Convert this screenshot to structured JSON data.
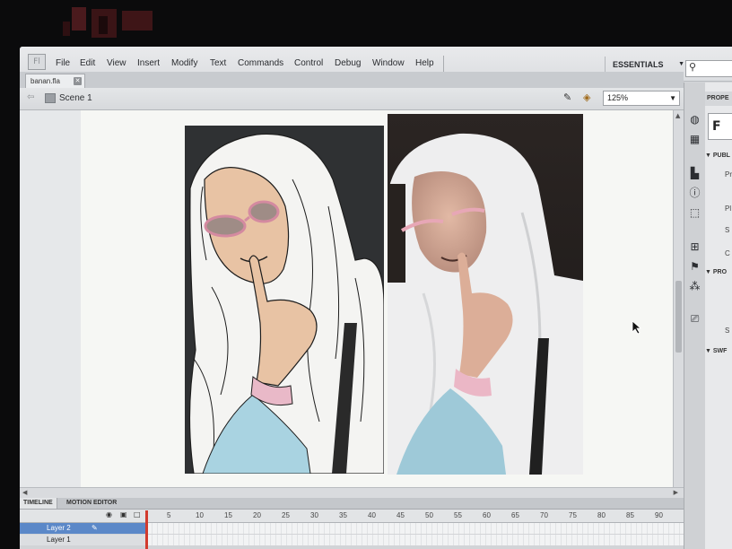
{
  "menu": {
    "items": [
      "File",
      "Edit",
      "View",
      "Insert",
      "Modify",
      "Text",
      "Commands",
      "Control",
      "Debug",
      "Window",
      "Help"
    ]
  },
  "workspace": {
    "label": "ESSENTIALS"
  },
  "document": {
    "tab_name": "banan.fla"
  },
  "scene": {
    "label": "Scene 1"
  },
  "zoom": {
    "value": "125%"
  },
  "properties": {
    "header": "PROPE",
    "doc_letter": "F",
    "sections": [
      "PUBL",
      "PRO",
      "SWF"
    ],
    "labels": [
      "Pr",
      "Pl",
      "S",
      "C",
      "S"
    ]
  },
  "timeline": {
    "tabs": [
      "TIMELINE",
      "MOTION EDITOR"
    ],
    "frame_numbers": [
      "5",
      "10",
      "15",
      "20",
      "25",
      "30",
      "35",
      "40",
      "45",
      "50",
      "55",
      "60",
      "65",
      "70",
      "75",
      "80",
      "85",
      "90"
    ],
    "layers": [
      {
        "name": "Layer 2",
        "selected": true
      },
      {
        "name": "Layer 1",
        "selected": false
      }
    ]
  },
  "colors": {
    "accent": "#5b88c8",
    "playhead": "#d23b2e",
    "hijab": "#f4f4f2",
    "skin": "#e8c3a4",
    "sleeve": "#a9d3e1"
  },
  "icons": {
    "dock": [
      "palette-icon",
      "swatches-icon",
      "align-icon",
      "info-icon",
      "transform-icon",
      "library-icon",
      "components-icon",
      "motion-presets-icon",
      "projector-icon"
    ]
  }
}
